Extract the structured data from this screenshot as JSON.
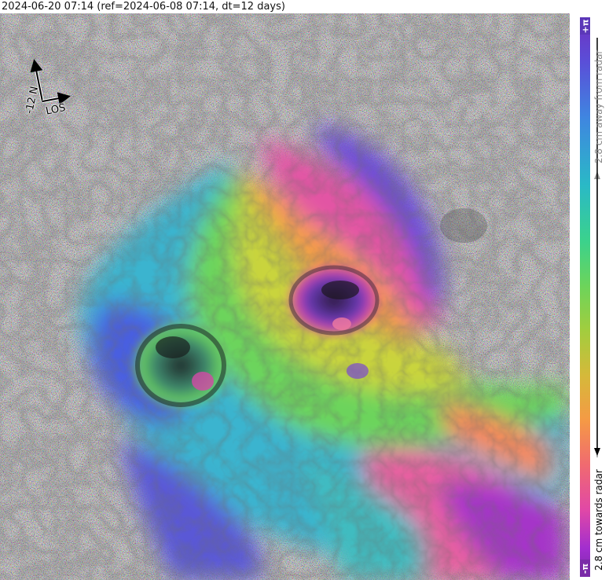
{
  "header": {
    "title": "2024-06-20 07:14 (ref=2024-06-08 07:14, dt=12 days)"
  },
  "compass": {
    "north_label": "-12 N",
    "los_label": "LOS"
  },
  "colorbar": {
    "top_label": "+π",
    "bottom_label": "-π",
    "away_label": "2.8 cm away from radar",
    "towards_label": "2.8 cm towards radar",
    "colors": [
      "#7030c0",
      "#3f86e0",
      "#2ab9c6",
      "#6cd45b",
      "#d5b93a",
      "#f59a45",
      "#e148a6",
      "#7a2aa8"
    ]
  },
  "map": {
    "description_icon": "interferogram-image",
    "features": [
      "crater-east",
      "crater-west"
    ]
  }
}
